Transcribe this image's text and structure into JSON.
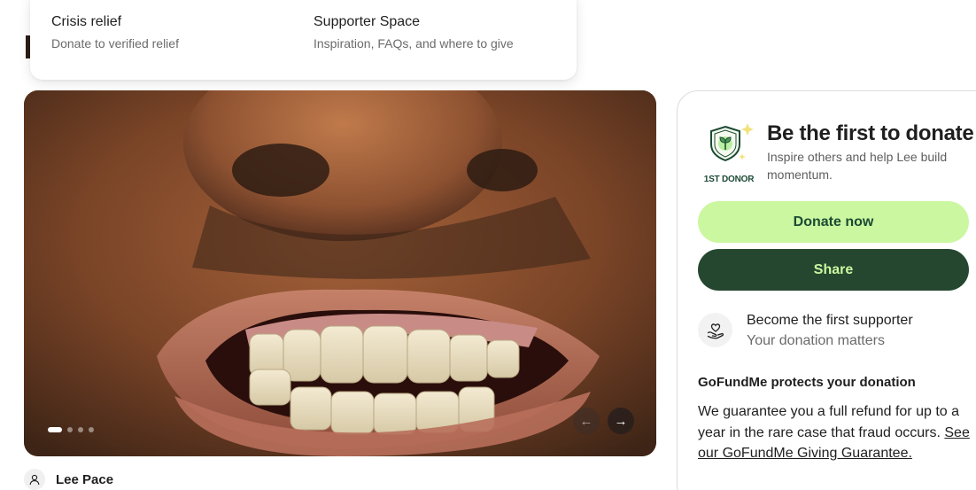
{
  "menu": {
    "items": [
      {
        "title": "Crisis relief",
        "description": "Donate to verified relief"
      },
      {
        "title": "Supporter Space",
        "description": "Inspiration, FAQs, and where to give"
      }
    ]
  },
  "carousel": {
    "slide_count": 4,
    "active_slide": 1,
    "prev_icon": "arrow-left-icon",
    "next_icon": "arrow-right-icon"
  },
  "organizer": {
    "name": "Lee Pace",
    "icon": "user-icon"
  },
  "donate_card": {
    "badge_label": "1ST DONOR",
    "title": "Be the first to donate",
    "subtitle": "Inspire others and help Lee build momentum.",
    "donate_button": "Donate now",
    "share_button": "Share",
    "supporter": {
      "title": "Become the first supporter",
      "subtitle": "Your donation matters",
      "icon": "heart-hand-icon"
    },
    "protection": {
      "heading": "GoFundMe protects your donation",
      "text": "We guarantee you a full refund for up to a year in the rare case that fraud occurs.",
      "link": "See our GoFundMe Giving Guarantee."
    }
  },
  "colors": {
    "brand_green_light": "#cbf7a0",
    "brand_green_dark": "#25472f",
    "text_dark": "#1f1f1f",
    "text_muted": "#6b6b6b"
  }
}
